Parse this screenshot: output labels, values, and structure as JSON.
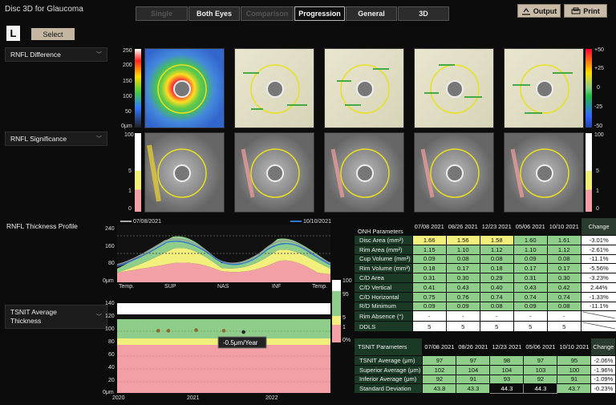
{
  "app": {
    "title": "Disc 3D for Glaucoma",
    "eye": "L",
    "select_label": "Select"
  },
  "tabs": [
    {
      "label": "Single",
      "state": "disabled"
    },
    {
      "label": "Both Eyes",
      "state": "normal"
    },
    {
      "label": "Comparison",
      "state": "disabled"
    },
    {
      "label": "Progression",
      "state": "active"
    },
    {
      "label": "General",
      "state": "normal"
    },
    {
      "label": "3D",
      "state": "normal"
    }
  ],
  "toolbar": {
    "output_label": "Output",
    "print_label": "Print"
  },
  "rnfl_diff": {
    "label": "RNFL Difference",
    "left_scale": [
      "250",
      "200",
      "150",
      "100",
      "50",
      "0μm"
    ],
    "right_scale": [
      "+50",
      "+25",
      "0",
      "-25",
      "-50"
    ]
  },
  "rnfl_sig": {
    "label": "RNFL Significance",
    "left_scale": [
      "100",
      "5",
      "1",
      "0"
    ],
    "right_scale": [
      "100",
      "5",
      "1",
      "0"
    ]
  },
  "profile": {
    "label": "RNFL Thickness Profile",
    "legend": [
      "07/08/2021",
      "10/10/2021"
    ],
    "y_ticks": [
      "240",
      "160",
      "80",
      "0μm"
    ],
    "x_ticks": [
      "Temp.",
      "SUP",
      "NAS",
      "INF",
      "Temp."
    ],
    "band_ticks": [
      "100",
      "95",
      "5",
      "1",
      "0%"
    ]
  },
  "tsnit": {
    "label": "TSNIT Average Thickness",
    "y_ticks": [
      "140",
      "120",
      "100",
      "80",
      "60",
      "40",
      "20",
      "0μm"
    ],
    "x_ticks": [
      "2020",
      "2021",
      "2022"
    ],
    "rate": "-0.5μm/Year",
    "points_years": [
      2020.52,
      2020.65,
      2021.0,
      2021.35,
      2021.6
    ],
    "points_values": [
      97,
      97,
      98,
      97,
      95
    ]
  },
  "onh": {
    "title": "ONH Parameters",
    "dates": [
      "07/08 2021",
      "08/26 2021",
      "12/23 2021",
      "05/06 2021",
      "10/10 2021"
    ],
    "change_label": "Change",
    "rows": [
      {
        "name": "Disc Area (mm²)",
        "values": [
          "1.66",
          "1.56",
          "1.58",
          "1.60",
          "1.61"
        ],
        "classes": [
          "y",
          "y",
          "y",
          "g",
          "g"
        ],
        "change": "-3.01%"
      },
      {
        "name": "Rim Area (mm²)",
        "values": [
          "1.15",
          "1.10",
          "1.12",
          "1.10",
          "1.12"
        ],
        "classes": [
          "g",
          "g",
          "g",
          "g",
          "g"
        ],
        "change": "-2.61%"
      },
      {
        "name": "Cup Volume (mm³)",
        "values": [
          "0.09",
          "0.08",
          "0.08",
          "0.09",
          "0.08"
        ],
        "classes": [
          "g",
          "g",
          "g",
          "g",
          "g"
        ],
        "change": "-11.1%"
      },
      {
        "name": "Rim Volume (mm³)",
        "values": [
          "0.18",
          "0.17",
          "0.18",
          "0.17",
          "0.17"
        ],
        "classes": [
          "g",
          "g",
          "g",
          "g",
          "g"
        ],
        "change": "-5.56%"
      },
      {
        "name": "C/D Area",
        "values": [
          "0.31",
          "0.30",
          "0.29",
          "0.31",
          "0.30"
        ],
        "classes": [
          "g",
          "g",
          "g",
          "g",
          "g"
        ],
        "change": "-3.23%"
      },
      {
        "name": "C/D Vertical",
        "values": [
          "0.41",
          "0.43",
          "0.40",
          "0.43",
          "0.42"
        ],
        "classes": [
          "g",
          "g",
          "g",
          "g",
          "g"
        ],
        "change": "2.44%"
      },
      {
        "name": "C/D Horizontal",
        "values": [
          "0.75",
          "0.76",
          "0.74",
          "0.74",
          "0.74"
        ],
        "classes": [
          "g",
          "g",
          "g",
          "g",
          "g"
        ],
        "change": "-1.33%"
      },
      {
        "name": "R/D Minimum",
        "values": [
          "0.09",
          "0.09",
          "0.08",
          "0.09",
          "0.08"
        ],
        "classes": [
          "g",
          "g",
          "g",
          "g",
          "g"
        ],
        "change": "-11.1%"
      },
      {
        "name": "Rim Absence (°)",
        "values": [
          "-",
          "-",
          "-",
          "-",
          "-"
        ],
        "classes": [
          "w",
          "w",
          "w",
          "w",
          "w"
        ],
        "change": ""
      },
      {
        "name": "DDLS",
        "values": [
          "5",
          "5",
          "5",
          "5",
          "5"
        ],
        "classes": [
          "w",
          "w",
          "w",
          "w",
          "w"
        ],
        "change": ""
      }
    ]
  },
  "tsnit_table": {
    "title": "TSNIT Parameters",
    "dates": [
      "07/08 2021",
      "08/26 2021",
      "12/23 2021",
      "05/06 2021",
      "10/10 2021"
    ],
    "change_label": "Change",
    "rows": [
      {
        "name": "TSNIT Average (μm)",
        "values": [
          "97",
          "97",
          "98",
          "97",
          "95"
        ],
        "classes": [
          "g",
          "g",
          "g",
          "g",
          "g"
        ],
        "change": "-2.06%"
      },
      {
        "name": "Superior Average (μm)",
        "values": [
          "102",
          "104",
          "104",
          "103",
          "100"
        ],
        "classes": [
          "g",
          "g",
          "g",
          "g",
          "g"
        ],
        "change": "-1.96%"
      },
      {
        "name": "Inferior Average (μm)",
        "values": [
          "92",
          "91",
          "93",
          "92",
          "91"
        ],
        "classes": [
          "g",
          "g",
          "g",
          "g",
          "g"
        ],
        "change": "-1.09%"
      },
      {
        "name": "Standard Deviation",
        "values": [
          "43.8",
          "43.3",
          "44.3",
          "44.3",
          "43.7"
        ],
        "classes": [
          "g",
          "g",
          "k",
          "k",
          "g"
        ],
        "change": "-0.23%"
      }
    ]
  },
  "colors": {
    "green": "#8fcd8a",
    "yellow": "#f3ef7c",
    "red_band": "#f2a0a6",
    "accent_button": "#c9bba8"
  }
}
